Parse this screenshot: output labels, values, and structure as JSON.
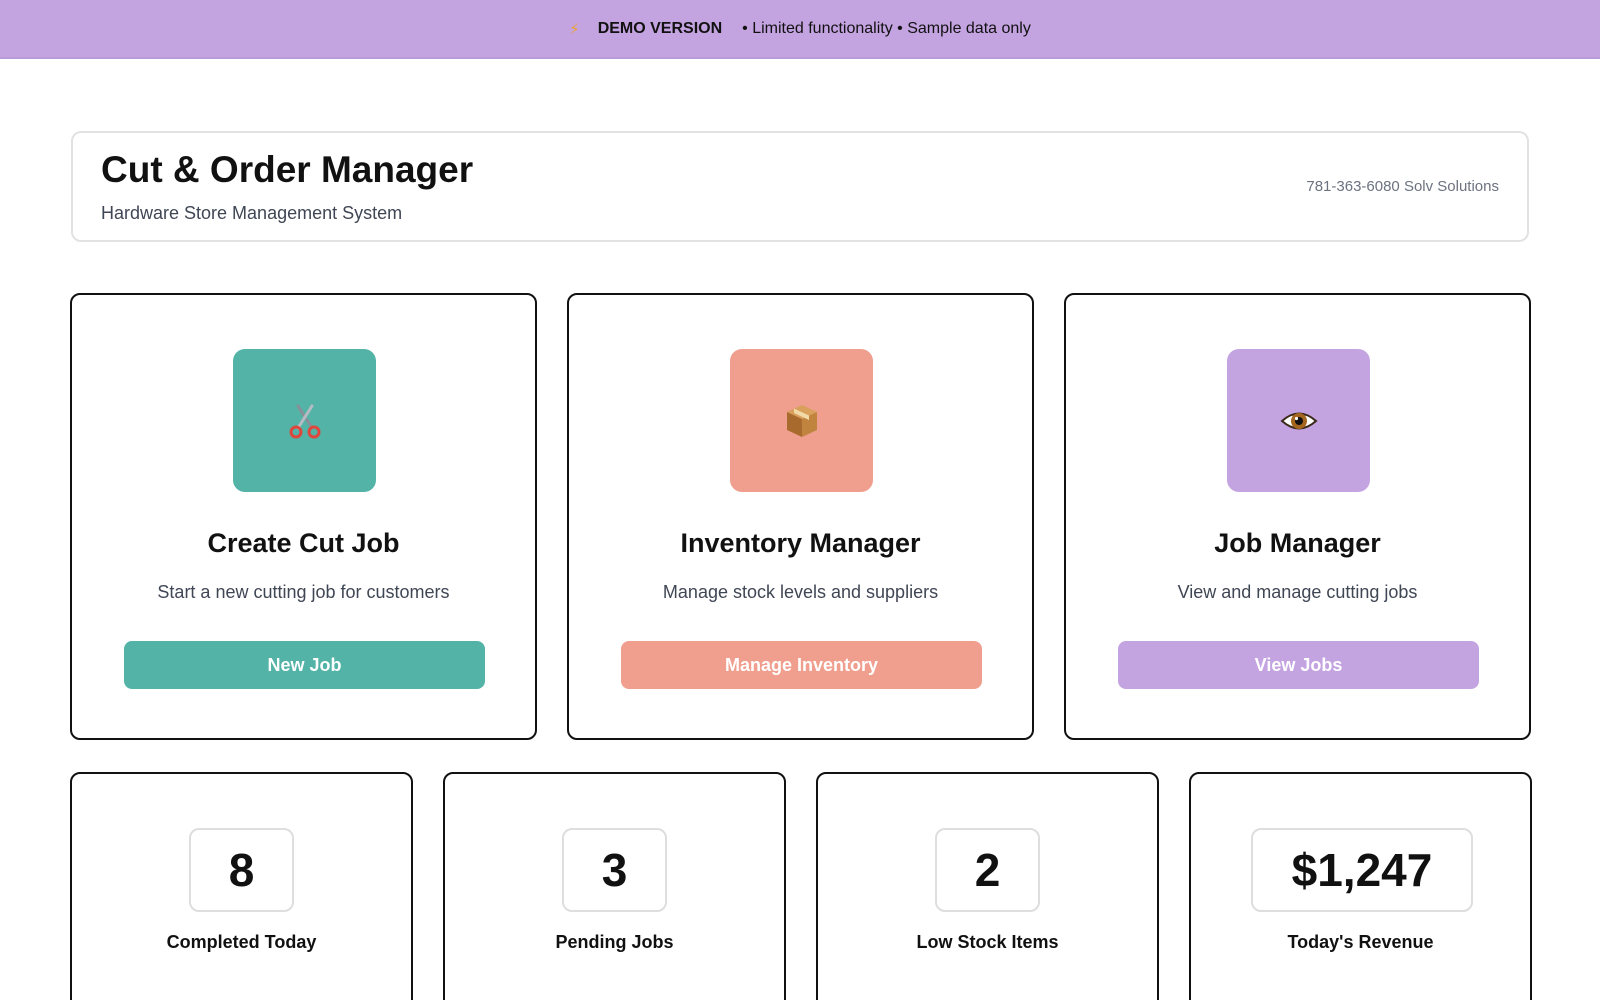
{
  "banner": {
    "icon": "lightning-bolt-icon",
    "title": "DEMO VERSION",
    "message": "• Limited functionality • Sample data only",
    "background": "#c4a3e1"
  },
  "header": {
    "title": "Cut & Order Manager",
    "subtitle": "Hardware Store Management System",
    "contact": "781-363-6080 Solv Solutions"
  },
  "actions": [
    {
      "icon": "scissors-icon",
      "title": "Create Cut Job",
      "description": "Start a new cutting job for customers",
      "button_label": "New Job",
      "color": "#52b3a6"
    },
    {
      "icon": "package-icon",
      "title": "Inventory Manager",
      "description": "Manage stock levels and suppliers",
      "button_label": "Manage Inventory",
      "color": "#f09e8e"
    },
    {
      "icon": "eye-icon",
      "title": "Job Manager",
      "description": "View and manage cutting jobs",
      "button_label": "View Jobs",
      "color": "#c4a3e1"
    }
  ],
  "stats": [
    {
      "value": "8",
      "label": "Completed Today"
    },
    {
      "value": "3",
      "label": "Pending Jobs"
    },
    {
      "value": "2",
      "label": "Low Stock Items"
    },
    {
      "value": "$1,247",
      "label": "Today's Revenue"
    }
  ]
}
